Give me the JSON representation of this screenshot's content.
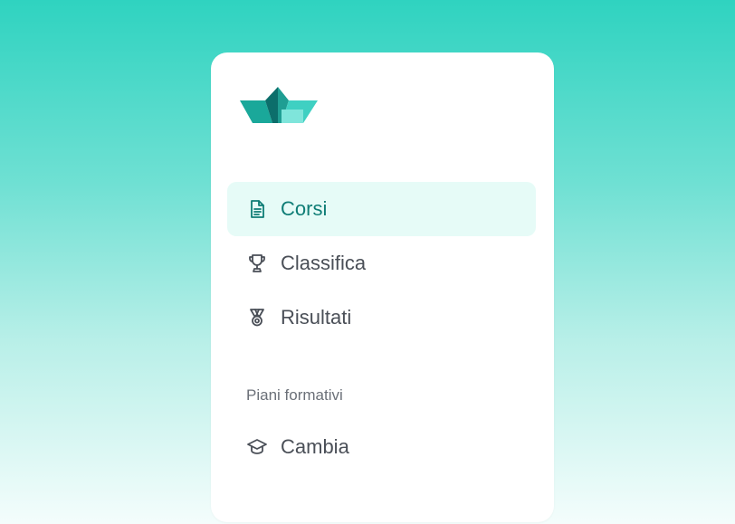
{
  "logo": {
    "icon": "paper-boat-logo",
    "colors": [
      "#0c6e6b",
      "#1aa89a",
      "#3fd0c2",
      "#7fe5db"
    ]
  },
  "nav": {
    "items": [
      {
        "label": "Corsi",
        "icon": "document-icon",
        "active": true
      },
      {
        "label": "Classifica",
        "icon": "trophy-icon",
        "active": false
      },
      {
        "label": "Risultati",
        "icon": "medal-icon",
        "active": false
      }
    ]
  },
  "section": {
    "title": "Piani formativi",
    "items": [
      {
        "label": "Cambia",
        "icon": "graduation-cap-icon"
      }
    ]
  },
  "colors": {
    "accent": "#0f7d76",
    "active_bg": "#e6fbf7",
    "text": "#4a4f57",
    "muted": "#6b7078"
  }
}
